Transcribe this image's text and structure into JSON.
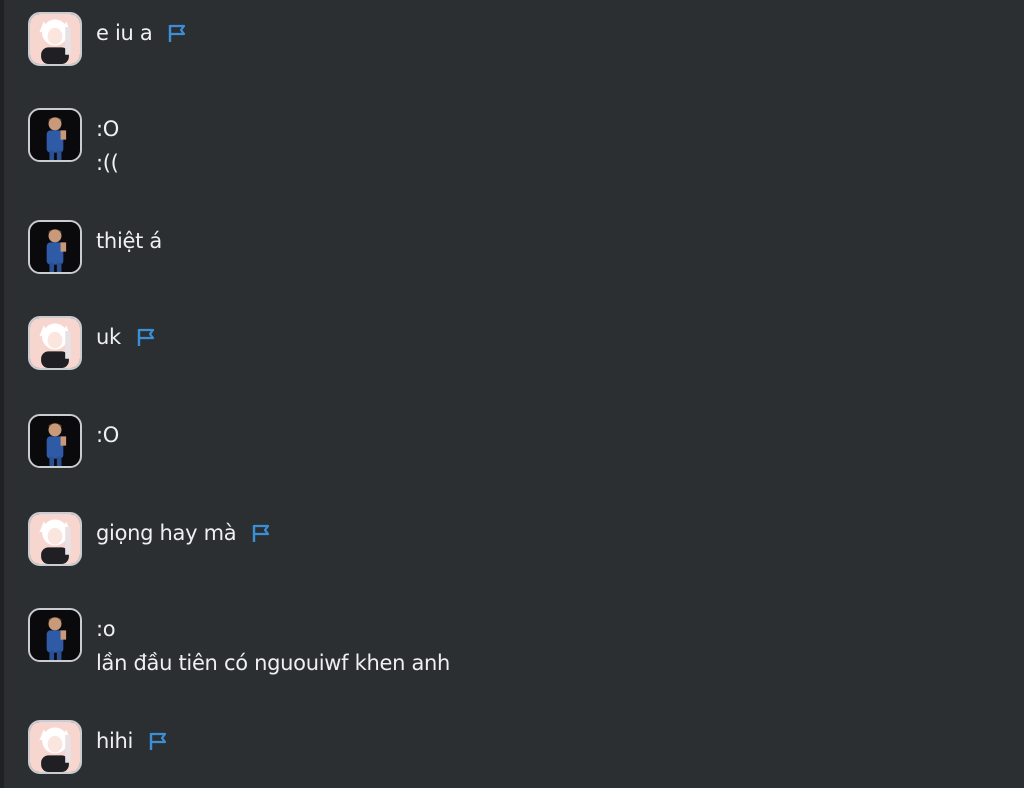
{
  "messages": [
    {
      "author": "girl",
      "lines": [
        "e iu a"
      ],
      "flag": true
    },
    {
      "author": "boy",
      "lines": [
        ":O",
        ":(("
      ],
      "flag": false
    },
    {
      "author": "boy",
      "lines": [
        "thiệt á"
      ],
      "flag": false
    },
    {
      "author": "girl",
      "lines": [
        "uk"
      ],
      "flag": true
    },
    {
      "author": "boy",
      "lines": [
        ":O"
      ],
      "flag": false
    },
    {
      "author": "girl",
      "lines": [
        "giọng hay mà"
      ],
      "flag": true
    },
    {
      "author": "boy",
      "lines": [
        ":o",
        "lần đầu tiên có nguouiwf khen anh"
      ],
      "flag": false
    },
    {
      "author": "girl",
      "lines": [
        "hihi"
      ],
      "flag": true
    }
  ],
  "colors": {
    "background": "#2c2f32",
    "text": "#eef0f2",
    "flag": "#3b8fd6"
  },
  "icons": {
    "flag": "flag-icon",
    "girl_avatar": "avatar-girl",
    "boy_avatar": "avatar-boy"
  }
}
